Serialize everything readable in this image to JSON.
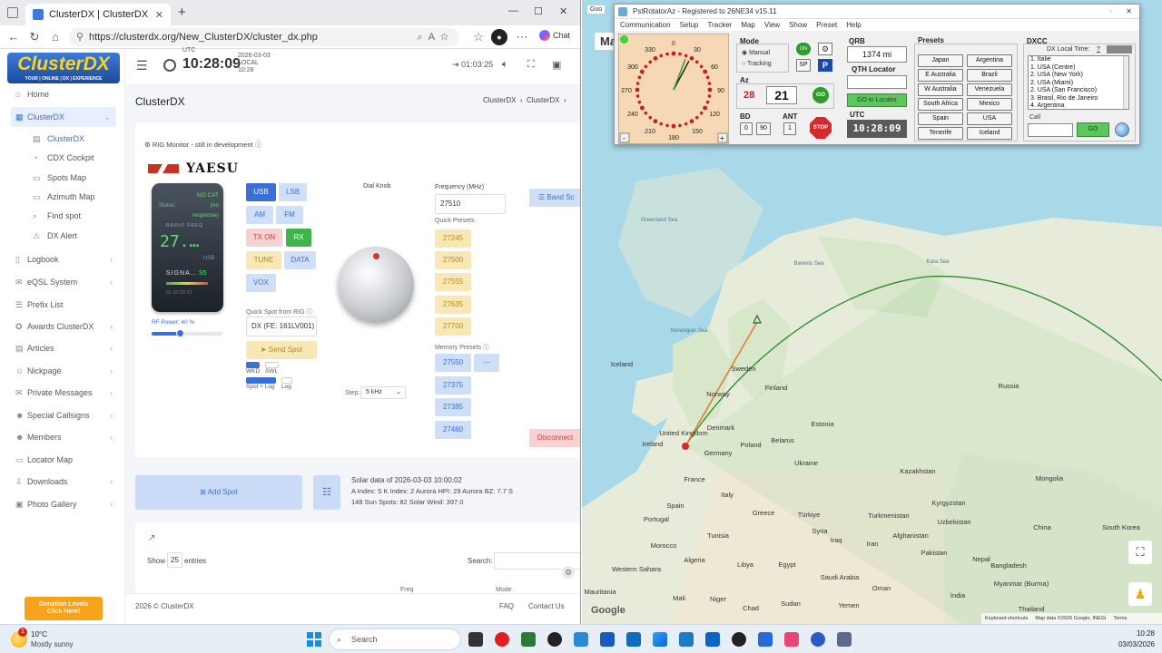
{
  "browser": {
    "tab_title": "ClusterDX | ClusterDX",
    "url": "https://clusterdx.org/New_ClusterDX/cluster_dx.php",
    "chat_label": "Chat"
  },
  "sidebar": {
    "logo_text": "ClusterDX",
    "logo_sub": "YOUR | ONLINE | DX | EXPERIENCE",
    "items": [
      {
        "label": "Home",
        "icon": "home-icon"
      },
      {
        "label": "ClusterDX",
        "icon": "grid-icon"
      },
      {
        "label": "ClusterDX",
        "icon": "table-icon"
      },
      {
        "label": "CDX Cockpit",
        "icon": "gauge-icon"
      },
      {
        "label": "Spots Map",
        "icon": "map-icon"
      },
      {
        "label": "Azimuth Map",
        "icon": "map-icon"
      },
      {
        "label": "Find spot",
        "icon": "search-icon"
      },
      {
        "label": "DX Alert",
        "icon": "bell-icon"
      },
      {
        "label": "Logbook",
        "icon": "book-icon"
      },
      {
        "label": "eQSL System",
        "icon": "mail-icon"
      },
      {
        "label": "Prefix List",
        "icon": "list-icon"
      },
      {
        "label": "Awards ClusterDX",
        "icon": "award-icon"
      },
      {
        "label": "Articles",
        "icon": "article-icon"
      },
      {
        "label": "Nickpage",
        "icon": "user-icon"
      },
      {
        "label": "Private Messages",
        "icon": "chat-icon"
      },
      {
        "label": "Special Callsigns",
        "icon": "users-icon"
      },
      {
        "label": "Members",
        "icon": "users-icon"
      },
      {
        "label": "Locator Map",
        "icon": "map-icon"
      },
      {
        "label": "Downloads",
        "icon": "download-icon"
      },
      {
        "label": "Photo Gallery",
        "icon": "photo-icon"
      }
    ],
    "donate_line1": "Donation Levels",
    "donate_line2": "Click Here!"
  },
  "header": {
    "utc_label": "UTC",
    "time": "10:28:09",
    "date": "2026-03-03",
    "local_label": "LOCAL",
    "local_time": "10:28",
    "timer": "01:03:25"
  },
  "page": {
    "title": "ClusterDX",
    "breadcrumb_1": "ClusterDX",
    "breadcrumb_2": "ClusterDX"
  },
  "rig": {
    "section_title": "RIG Monitor - still in development",
    "brand": "YAESU",
    "no_cat": "NO CAT",
    "no_response": "(no response)",
    "status_label": "Status:",
    "radio_freq_label": "RADIO FREQ",
    "freq_display": "27.…",
    "mode_display": "USB",
    "signal_label": "SIGNA…",
    "signal_value": "S5",
    "smeter_scale": "S1 S3 S5 S7",
    "rf_power_label": "RF Power: 40 %",
    "rf_power": 0.4,
    "mode_buttons": [
      "USB",
      "LSB",
      "AM",
      "FM",
      "TX ON",
      "RX",
      "TUNE",
      "DATA",
      "VOX"
    ],
    "quick_spot_label": "Quick Spot from RIG",
    "quick_spot_value": "DX (FE: 161LV001)",
    "send_spot": "Send Spot",
    "wkd": "WKD",
    "swl": "SWL",
    "spot_log": "Spot + Log",
    "log": "Log",
    "dial_label": "Dial Knob",
    "step_label": "Step:",
    "step_value": "5 kHz",
    "freq_label": "Frequency (MHz)",
    "freq_value": "27510",
    "quick_presets_label": "Quick Presets",
    "quick_presets": [
      "27245",
      "27500",
      "27555",
      "27635",
      "27700"
    ],
    "memory_presets_label": "Memory Presets",
    "memory_presets": [
      "27550",
      "27375",
      "27385",
      "27460"
    ],
    "memory_empty": "---",
    "band_scope": "Band Sc",
    "disconnect": "Disconnect"
  },
  "solar": {
    "add_spot": "Add Spot",
    "title": "Solar data of 2026-03-03 10:00:02",
    "line1": "A Index: 5  K Index: 2  Aurora HPI: 29  Aurora BZ: 7.7  S",
    "line2": "148  Sun Spots: 82  Solar Wind: 397.0"
  },
  "table": {
    "show": "Show",
    "entries_value": "25",
    "entries": "entries",
    "search": "Search:",
    "col_freq": "Freq",
    "col_mode": "Mode"
  },
  "footer": {
    "copyright": "2026 © ClusterDX",
    "faq": "FAQ",
    "contact": "Contact Us"
  },
  "map": {
    "back_title_1": "Goo",
    "back_title_2": "Ma",
    "labels": [
      {
        "t": "Greenland Sea"
      },
      {
        "t": "Barents Sea"
      },
      {
        "t": "Kara Sea"
      },
      {
        "t": "Norwegian Sea"
      },
      {
        "t": "Iceland"
      },
      {
        "t": "Sweden"
      },
      {
        "t": "Finland"
      },
      {
        "t": "Norway"
      },
      {
        "t": "Russia"
      },
      {
        "t": "Estonia"
      },
      {
        "t": "Denmark"
      },
      {
        "t": "United Kingdom"
      },
      {
        "t": "Ireland"
      },
      {
        "t": "Belarus"
      },
      {
        "t": "Germany"
      },
      {
        "t": "Poland"
      },
      {
        "t": "Ukraine"
      },
      {
        "t": "France"
      },
      {
        "t": "Italy"
      },
      {
        "t": "Spain"
      },
      {
        "t": "Portugal"
      },
      {
        "t": "Kazakhstan"
      },
      {
        "t": "Mongolia"
      },
      {
        "t": "Kyrgyzstan"
      },
      {
        "t": "Turkmenistan"
      },
      {
        "t": "Uzbekistan"
      },
      {
        "t": "Türkiye"
      },
      {
        "t": "Greece"
      },
      {
        "t": "Tunisia"
      },
      {
        "t": "Morocco"
      },
      {
        "t": "Algeria"
      },
      {
        "t": "Libya"
      },
      {
        "t": "Egypt"
      },
      {
        "t": "Syria"
      },
      {
        "t": "Iraq"
      },
      {
        "t": "Iran"
      },
      {
        "t": "Afghanistan"
      },
      {
        "t": "Pakistan"
      },
      {
        "t": "China"
      },
      {
        "t": "South Korea"
      },
      {
        "t": "Nepal"
      },
      {
        "t": "India"
      },
      {
        "t": "Saudi Arabia"
      },
      {
        "t": "Oman"
      },
      {
        "t": "Yemen"
      },
      {
        "t": "Sudan"
      },
      {
        "t": "Chad"
      },
      {
        "t": "Niger"
      },
      {
        "t": "Mali"
      },
      {
        "t": "Mauritania"
      },
      {
        "t": "Western Sahara"
      },
      {
        "t": "Myanmar (Burma)"
      },
      {
        "t": "Bangladesh"
      },
      {
        "t": "Thailand"
      }
    ],
    "footer_shortcuts": "Keyboard shortcuts",
    "footer_data": "Map data ©2026 Google, INEGI",
    "footer_terms": "Terms",
    "google": "Google"
  },
  "rotator": {
    "title": "PstRotatorAz - Registered to 26NE34   v15.11",
    "menu": [
      "Communication",
      "Setup",
      "Tracker",
      "Map",
      "View",
      "Show",
      "Preset",
      "Help"
    ],
    "compass": [
      "0",
      "30",
      "60",
      "90",
      "120",
      "150",
      "180",
      "210",
      "240",
      "270",
      "300",
      "330"
    ],
    "compass_minus": "-",
    "compass_plus": "+",
    "mode_label": "Mode",
    "manual": "Manual",
    "tracking": "Tracking",
    "on_label": "ON",
    "sp_label": "SP",
    "az_label": "Az",
    "az_current": "28",
    "az_target": "21",
    "go": "GO",
    "bd_label": "BD",
    "ant_label": "ANT",
    "bd_0": "0",
    "bd_90": "90",
    "ant_1": "1",
    "stop": "STOP",
    "qrb_label": "QRB",
    "qrb_value": "1374 mi",
    "qth_label": "QTH Locator",
    "goto_locator": "GO to Locator",
    "utc_label": "UTC",
    "utc_value": "10:28:09",
    "presets_label": "Presets",
    "presets": [
      "Japan",
      "Argentina",
      "E Australia",
      "Brazil",
      "W Australia",
      "Venezuela",
      "South Africa",
      "Mexico",
      "Spain",
      "USA",
      "Tenerife",
      "Iceland"
    ],
    "dxcc_label": "DXCC",
    "dx_local_time": "DX Local Time:",
    "dx_local_q": "?",
    "dxcc_list": [
      "1.  Italie",
      "1.  USA (Centre)",
      "2.  USA (New York)",
      "2.  USA (Miami)",
      "2.  USA (San Francisco)",
      "3.  Brasil, Rio de Janeiro",
      "4.  Argentina"
    ],
    "call_label": "Call"
  },
  "taskbar": {
    "temp": "10°C",
    "weather": "Mostly sunny",
    "search": "Search",
    "time": "10:28",
    "date": "03/03/2026",
    "notif": "1"
  }
}
